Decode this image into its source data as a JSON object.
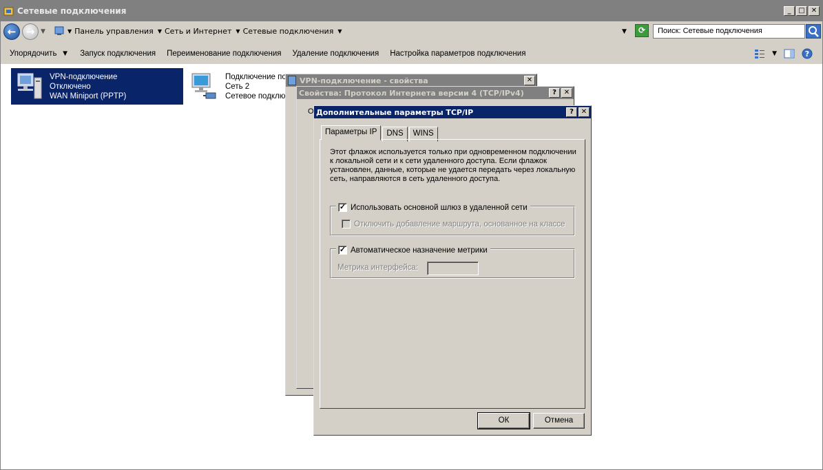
{
  "window": {
    "title": "Сетевые подключения",
    "controls": {
      "minimize": "_",
      "maximize": "□",
      "close": "✕"
    }
  },
  "address_bar": {
    "breadcrumbs": [
      "Панель управления",
      "Сеть и Интернет",
      "Сетевые подключения"
    ],
    "search_placeholder": "Поиск: Сетевые подключения"
  },
  "toolbar": {
    "organize": "Упорядочить",
    "items": [
      "Запуск подключения",
      "Переименование подключения",
      "Удаление подключения",
      "Настройка параметров подключения"
    ]
  },
  "connections": [
    {
      "name": "VPN-подключение",
      "status": "Отключено",
      "device": "WAN Miniport (PPTP)",
      "selected": true
    },
    {
      "name": "Подключение по",
      "status": "Сеть  2",
      "device": "Сетевое подключ",
      "selected": false
    }
  ],
  "dialogs": {
    "vpn_props": {
      "title": "VPN-подключение - свойства",
      "close": "✕"
    },
    "ipv4_props": {
      "title": "Свойства: Протокол Интернета версии 4 (TCP/IPv4)",
      "help": "?",
      "close": "✕",
      "fragment": "О"
    },
    "advanced": {
      "title": "Дополнительные параметры TCP/IP",
      "help": "?",
      "close": "✕",
      "tabs": [
        "Параметры IP",
        "DNS",
        "WINS"
      ],
      "active_tab": "Параметры IP",
      "description": "Этот флажок используется только при одновременном подключении к локальной сети и к сети удаленного доступа. Если флажок установлен, данные, которые не удается передать через локальную сеть, направляются в сеть удаленного доступа.",
      "use_default_gateway": {
        "label": "Использовать основной шлюз в удаленной сети",
        "checked": true
      },
      "disable_class_route": {
        "label": "Отключить добавление маршрута, основанное на классе",
        "checked": false,
        "enabled": false
      },
      "auto_metric": {
        "label": "Автоматическое назначение метрики",
        "checked": true
      },
      "interface_metric": {
        "label": "Метрика интерфейса:",
        "value": ""
      },
      "ok_label": "ОК",
      "cancel_label": "Отмена"
    }
  }
}
